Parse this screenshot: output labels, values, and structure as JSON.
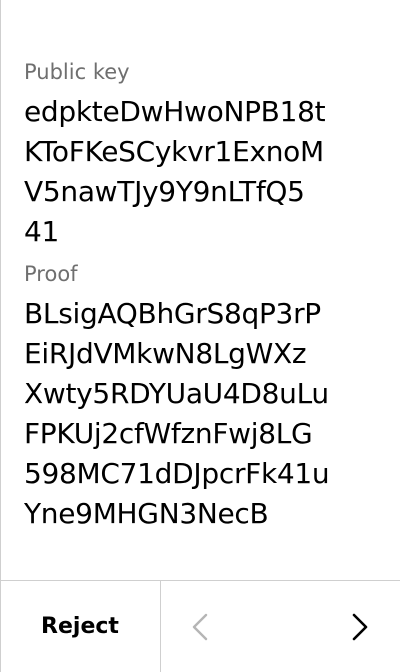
{
  "public_key": {
    "label": "Public key",
    "value_lines": [
      "edpkteDwHwoNPB18t",
      "KToFKeSCykvr1ExnoM",
      "V5nawTJy9Y9nLTfQ5",
      "41"
    ]
  },
  "proof": {
    "label": "Proof",
    "value_lines": [
      "BLsigAQBhGrS8qP3rP",
      "EiRJdVMkwN8LgWXz",
      "Xwty5RDYUaU4D8uLu",
      "FPKUj2cfWfznFwj8LG",
      "598MC71dDJpcrFk41u",
      "Yne9MHGN3NecB"
    ]
  },
  "footer": {
    "reject_label": "Reject",
    "prev_icon": "chevron-left-icon",
    "next_icon": "chevron-right-icon",
    "prev_enabled": false,
    "next_enabled": true
  },
  "colors": {
    "label": "#6f6f6f",
    "value": "#000000",
    "divider": "#cfcfcf",
    "disabled_icon": "#b5b5b5"
  }
}
